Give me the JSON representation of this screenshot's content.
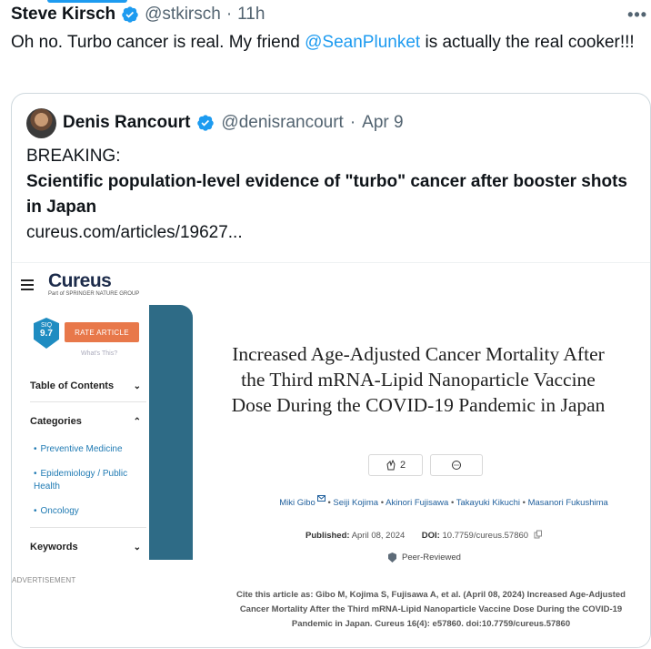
{
  "tweet": {
    "author_name": "Steve Kirsch",
    "handle": "@stkirsch",
    "time": "11h",
    "text_before": "Oh no. Turbo cancer is real. My friend ",
    "mention": "@SeanPlunket",
    "text_after": " is actually the real cooker!!!",
    "more_label": "•••"
  },
  "quote": {
    "author_name": "Denis Rancourt",
    "handle": "@denisrancourt",
    "date": "Apr 9",
    "line1": "BREAKING:",
    "headline": "Scientific population-level evidence of \"turbo\" cancer after booster shots in Japan",
    "link": "cureus.com/articles/19627..."
  },
  "article": {
    "logo": "Cureus",
    "logo_sub": "Part of SPRINGER NATURE GROUP",
    "siq_label": "SIQ",
    "siq_score": "9.7",
    "rate_button": "RATE ARTICLE",
    "whats_this": "What's This?",
    "sidebar": {
      "toc": "Table of Contents",
      "categories": "Categories",
      "category_items": [
        "Preventive Medicine",
        "Epidemiology / Public Health",
        "Oncology"
      ],
      "keywords": "Keywords"
    },
    "advertisement": "ADVERTISEMENT",
    "title": "Increased Age-Adjusted Cancer Mortality After the Third mRNA-Lipid Nanoparticle Vaccine Dose During the COVID-19 Pandemic in Japan",
    "like_count": "2",
    "authors": [
      "Miki Gibo",
      "Seiji Kojima",
      "Akinori Fujisawa",
      "Takayuki Kikuchi",
      "Masanori Fukushima"
    ],
    "published_label": "Published:",
    "published_date": "April 08, 2024",
    "doi_label": "DOI:",
    "doi": "10.7759/cureus.57860",
    "peer_reviewed": "Peer-Reviewed",
    "cite": "Cite this article as: Gibo M, Kojima S, Fujisawa A, et al. (April 08, 2024) Increased Age-Adjusted Cancer Mortality After the Third mRNA-Lipid Nanoparticle Vaccine Dose During the COVID-19 Pandemic in Japan. Cureus 16(4): e57860. doi:10.7759/cureus.57860"
  },
  "colors": {
    "verified": "#1d9bf0",
    "link": "#1d9bf0",
    "cureus_band": "#2e6b86",
    "rate_button": "#e8784a"
  }
}
